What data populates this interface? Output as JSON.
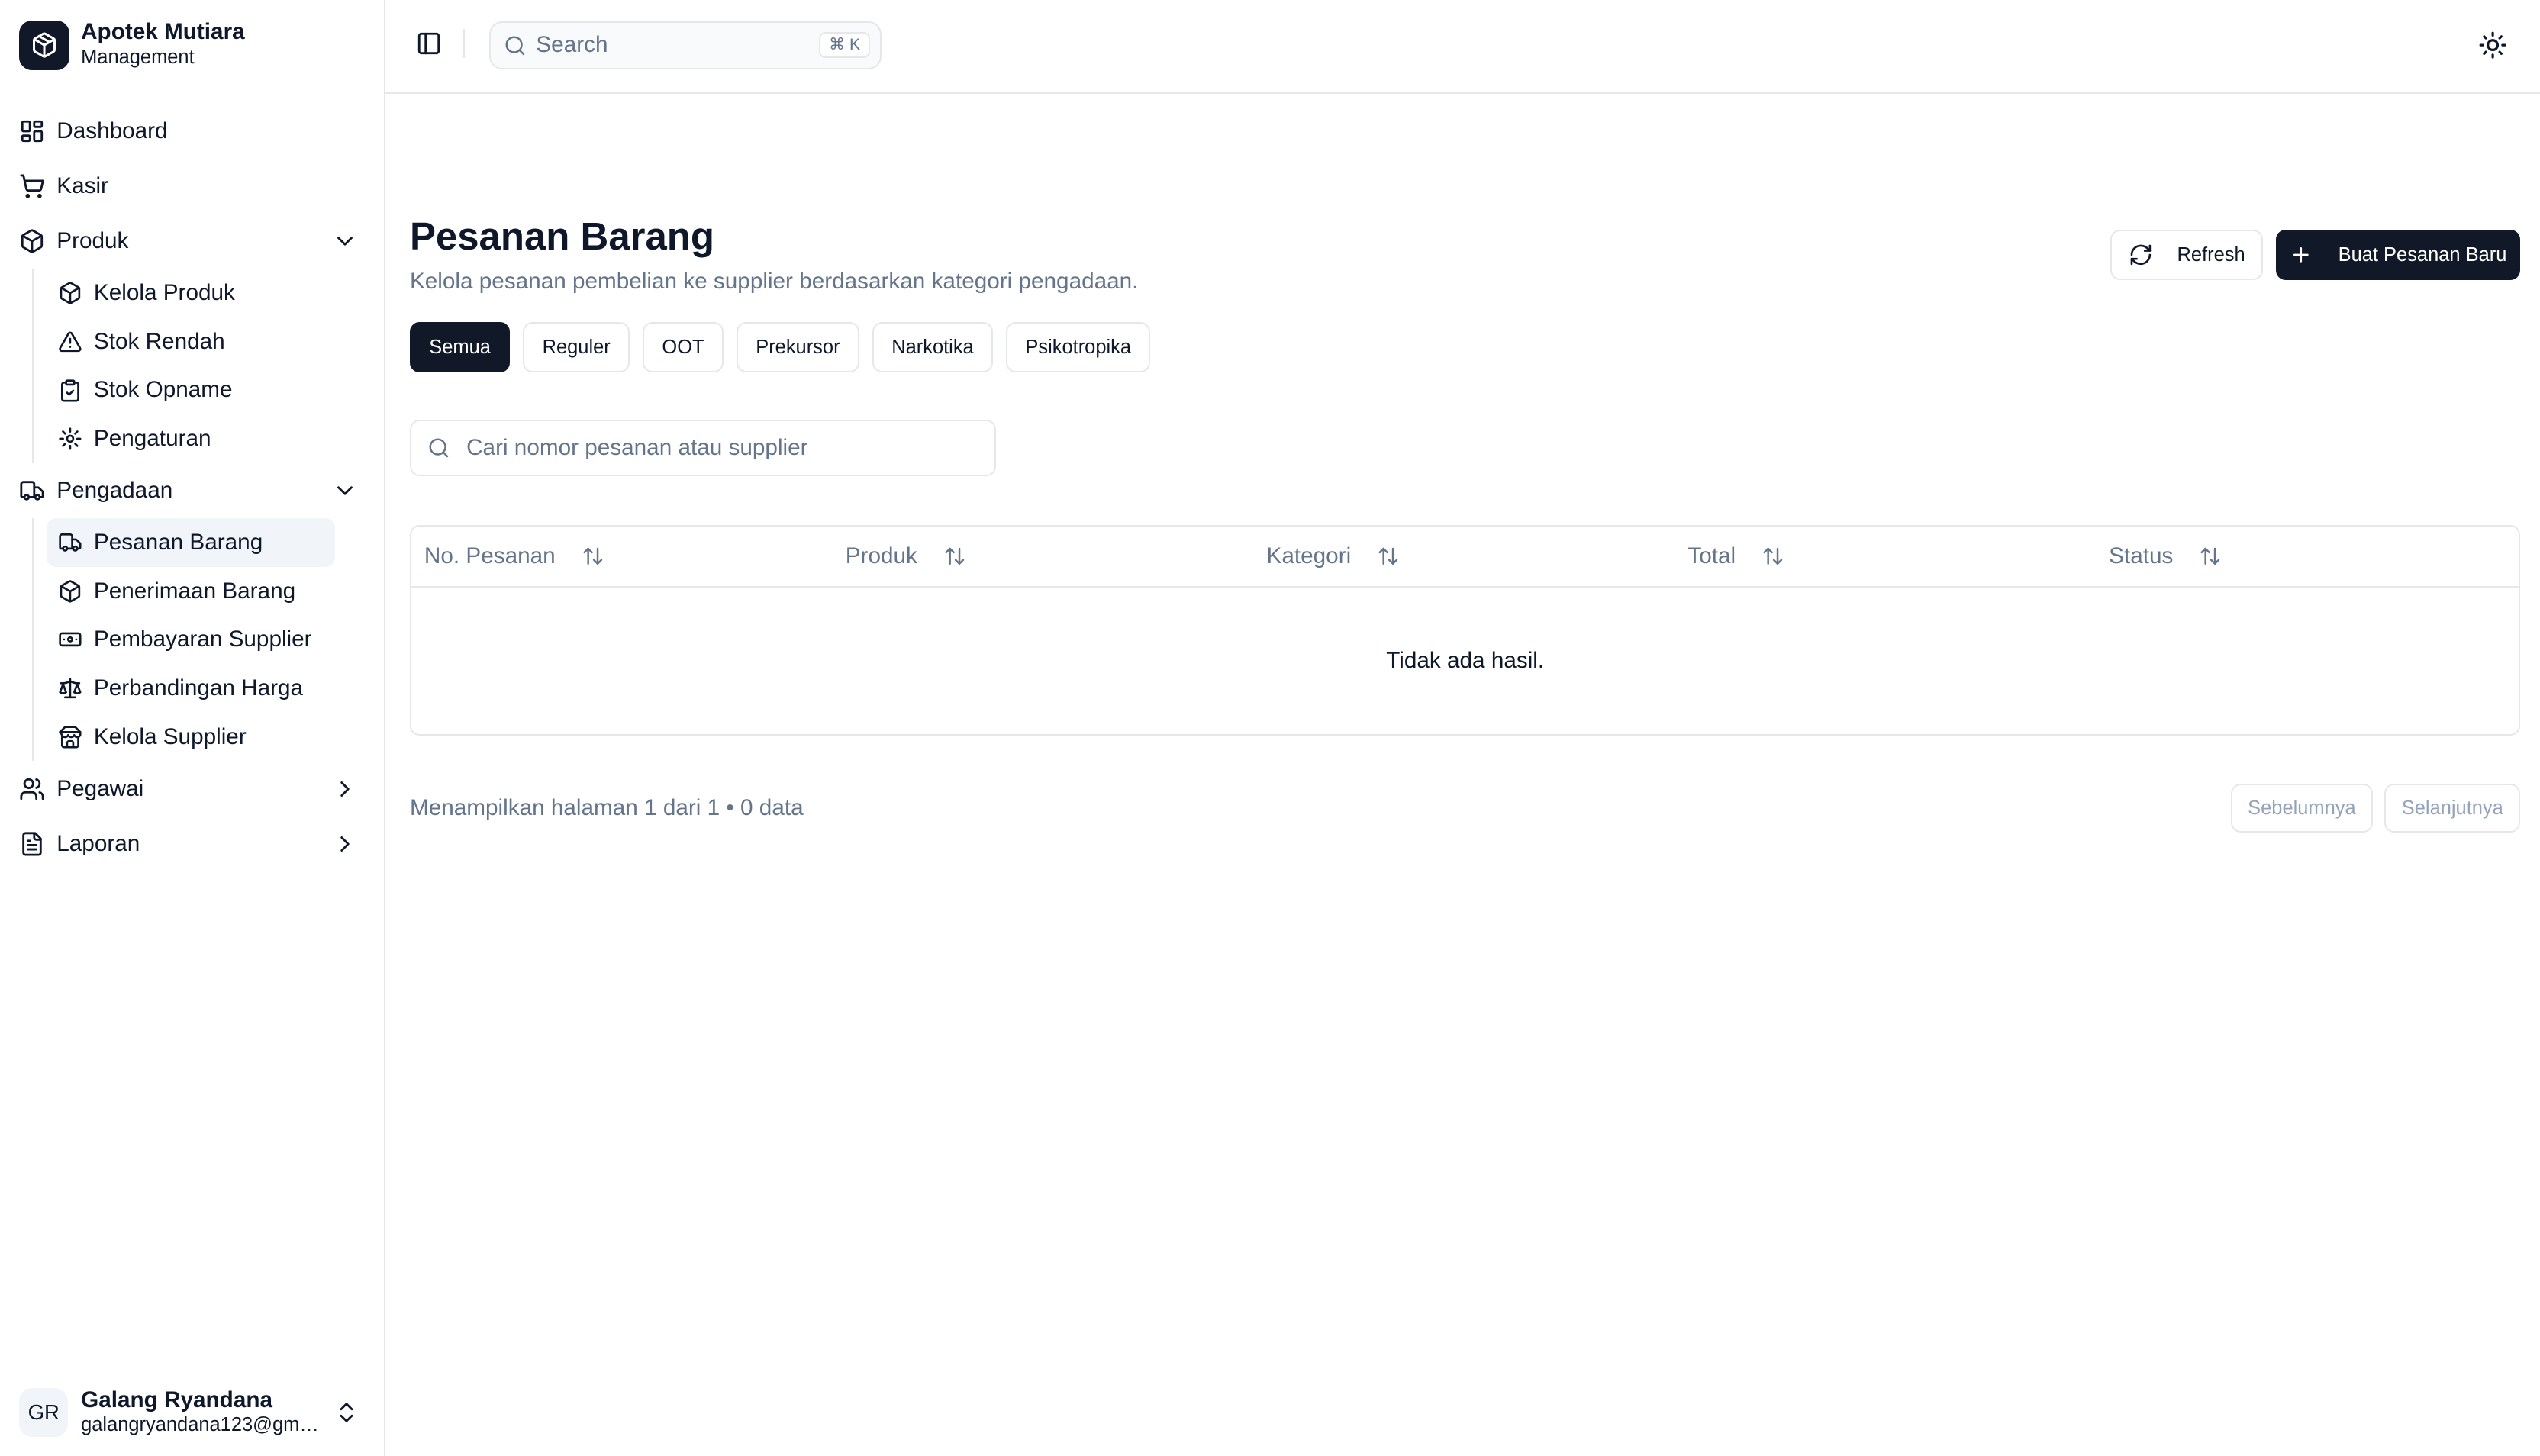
{
  "brand": {
    "title": "Apotek Mutiara",
    "subtitle": "Management"
  },
  "sidebar": {
    "top": [
      {
        "label": "Dashboard",
        "icon": "dashboard-icon"
      },
      {
        "label": "Kasir",
        "icon": "cart-icon"
      }
    ],
    "produk": {
      "label": "Produk",
      "items": [
        {
          "label": "Kelola Produk",
          "icon": "package-icon"
        },
        {
          "label": "Stok Rendah",
          "icon": "alert-triangle-icon"
        },
        {
          "label": "Stok Opname",
          "icon": "clipboard-check-icon"
        },
        {
          "label": "Pengaturan",
          "icon": "gear-icon"
        }
      ]
    },
    "pengadaan": {
      "label": "Pengadaan",
      "items": [
        {
          "label": "Pesanan Barang",
          "icon": "truck-icon",
          "active": true
        },
        {
          "label": "Penerimaan Barang",
          "icon": "package-icon"
        },
        {
          "label": "Pembayaran Supplier",
          "icon": "banknote-icon"
        },
        {
          "label": "Perbandingan Harga",
          "icon": "scale-icon"
        },
        {
          "label": "Kelola Supplier",
          "icon": "store-icon"
        }
      ]
    },
    "bottom": [
      {
        "label": "Pegawai",
        "icon": "users-icon"
      },
      {
        "label": "Laporan",
        "icon": "file-text-icon"
      }
    ]
  },
  "user": {
    "initials": "GR",
    "name": "Galang Ryandana",
    "email": "galangryandana123@gmail.com"
  },
  "topbar": {
    "search_placeholder": "Search",
    "shortcut": "⌘ K"
  },
  "page": {
    "title": "Pesanan Barang",
    "description": "Kelola pesanan pembelian ke supplier berdasarkan kategori pengadaan.",
    "refresh_label": "Refresh",
    "new_label": "Buat Pesanan Baru"
  },
  "tabs": [
    "Semua",
    "Reguler",
    "OOT",
    "Prekursor",
    "Narkotika",
    "Psikotropika"
  ],
  "active_tab": "Semua",
  "filter": {
    "placeholder": "Cari nomor pesanan atau supplier"
  },
  "table": {
    "columns": [
      "No. Pesanan",
      "Produk",
      "Kategori",
      "Total",
      "Status"
    ],
    "empty_text": "Tidak ada hasil."
  },
  "pagination": {
    "info": "Menampilkan halaman 1 dari 1 • 0 data",
    "prev_label": "Sebelumnya",
    "next_label": "Selanjutnya"
  },
  "colors": {
    "primary": "#111827",
    "border": "#e5e7eb",
    "muted": "#64748b",
    "active_bg": "#f1f5f9"
  }
}
